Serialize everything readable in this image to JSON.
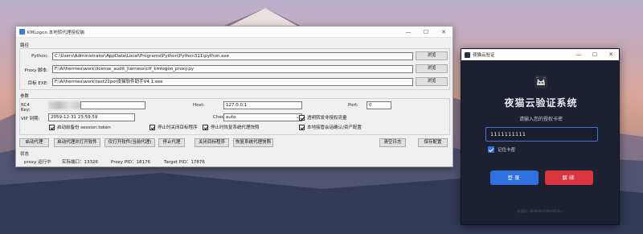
{
  "left_window": {
    "title": "KMLogon 本地转代理授权端",
    "controls": {
      "minimize": "—",
      "maximize": "☐",
      "close": "✕"
    },
    "paths_section": "路径",
    "python_label": "Python:",
    "python_value": "C:\\Users\\Administrator\\AppData\\Local\\Programs\\Python\\Python311\\python.exe",
    "proxy_label": "Proxy 脚本:",
    "proxy_value": "F:\\AI\\hermes\\work\\license_audit_harness\\ctf_kmlogon_proxy.py",
    "target_label": "目标 EXE:",
    "target_value": "F:\\AI\\hermes\\work\\test22po\\夜猫软件助手V4.1.exe",
    "browse_label": "浏览",
    "params_section": "参数",
    "rc4_label": "RC4 Key:",
    "host_label": "Host:",
    "host_value": "127.0.0.1",
    "port_label": "Port:",
    "port_value": "0",
    "vip_label": "VIP 到期:",
    "vip_value": "2059-12-31 23:59:59",
    "check_label": "Check:",
    "check_value": "auto",
    "checkboxes": {
      "passthrough": "透明转发非授权流量",
      "auto_backup": "启动前备份 session.token",
      "stop_on_close": "停止时关闭目标程序",
      "restore_proxy": "停止时恢复系统代理快照",
      "local_confirm": "本地接管会话确认/资产配置"
    },
    "buttons": {
      "start_proxy": "启动代理",
      "start_proxy_and_target": "启动代理并打开软件",
      "open_target_only": "仅打开软件(当前代理)",
      "stop_proxy": "停止代理",
      "close_target": "关闭目标程序",
      "restore_system_proxy": "恢复系统代理快照",
      "clear_log": "清空日志",
      "save_config": "保存配置"
    },
    "status_section": "状态",
    "status": {
      "running": "proxy 运行中",
      "actual_port": "实际端口：13326",
      "proxy_pid": "Proxy PID：18176",
      "target_pid": "Target PID：17876"
    }
  },
  "right_window": {
    "title": "夜猫云验证",
    "controls": {
      "minimize": "—",
      "maximize": "☐",
      "close": "✕"
    },
    "heading": "夜猫云验证系统",
    "subtitle": "请输入您的授权卡密",
    "card_key": "1111111111",
    "remember_label": "记住卡密",
    "login_label": "登录",
    "unbind_label": "解绑",
    "footer": "机器码: d6d6e0e7d8ef0f33c..."
  },
  "colors": {
    "login_button": "#2f6fe0",
    "unbind_button": "#d9343f",
    "accent_border": "#4a6fd8"
  },
  "icons": {
    "app": "app-icon",
    "logo": "cat-logo-icon"
  }
}
